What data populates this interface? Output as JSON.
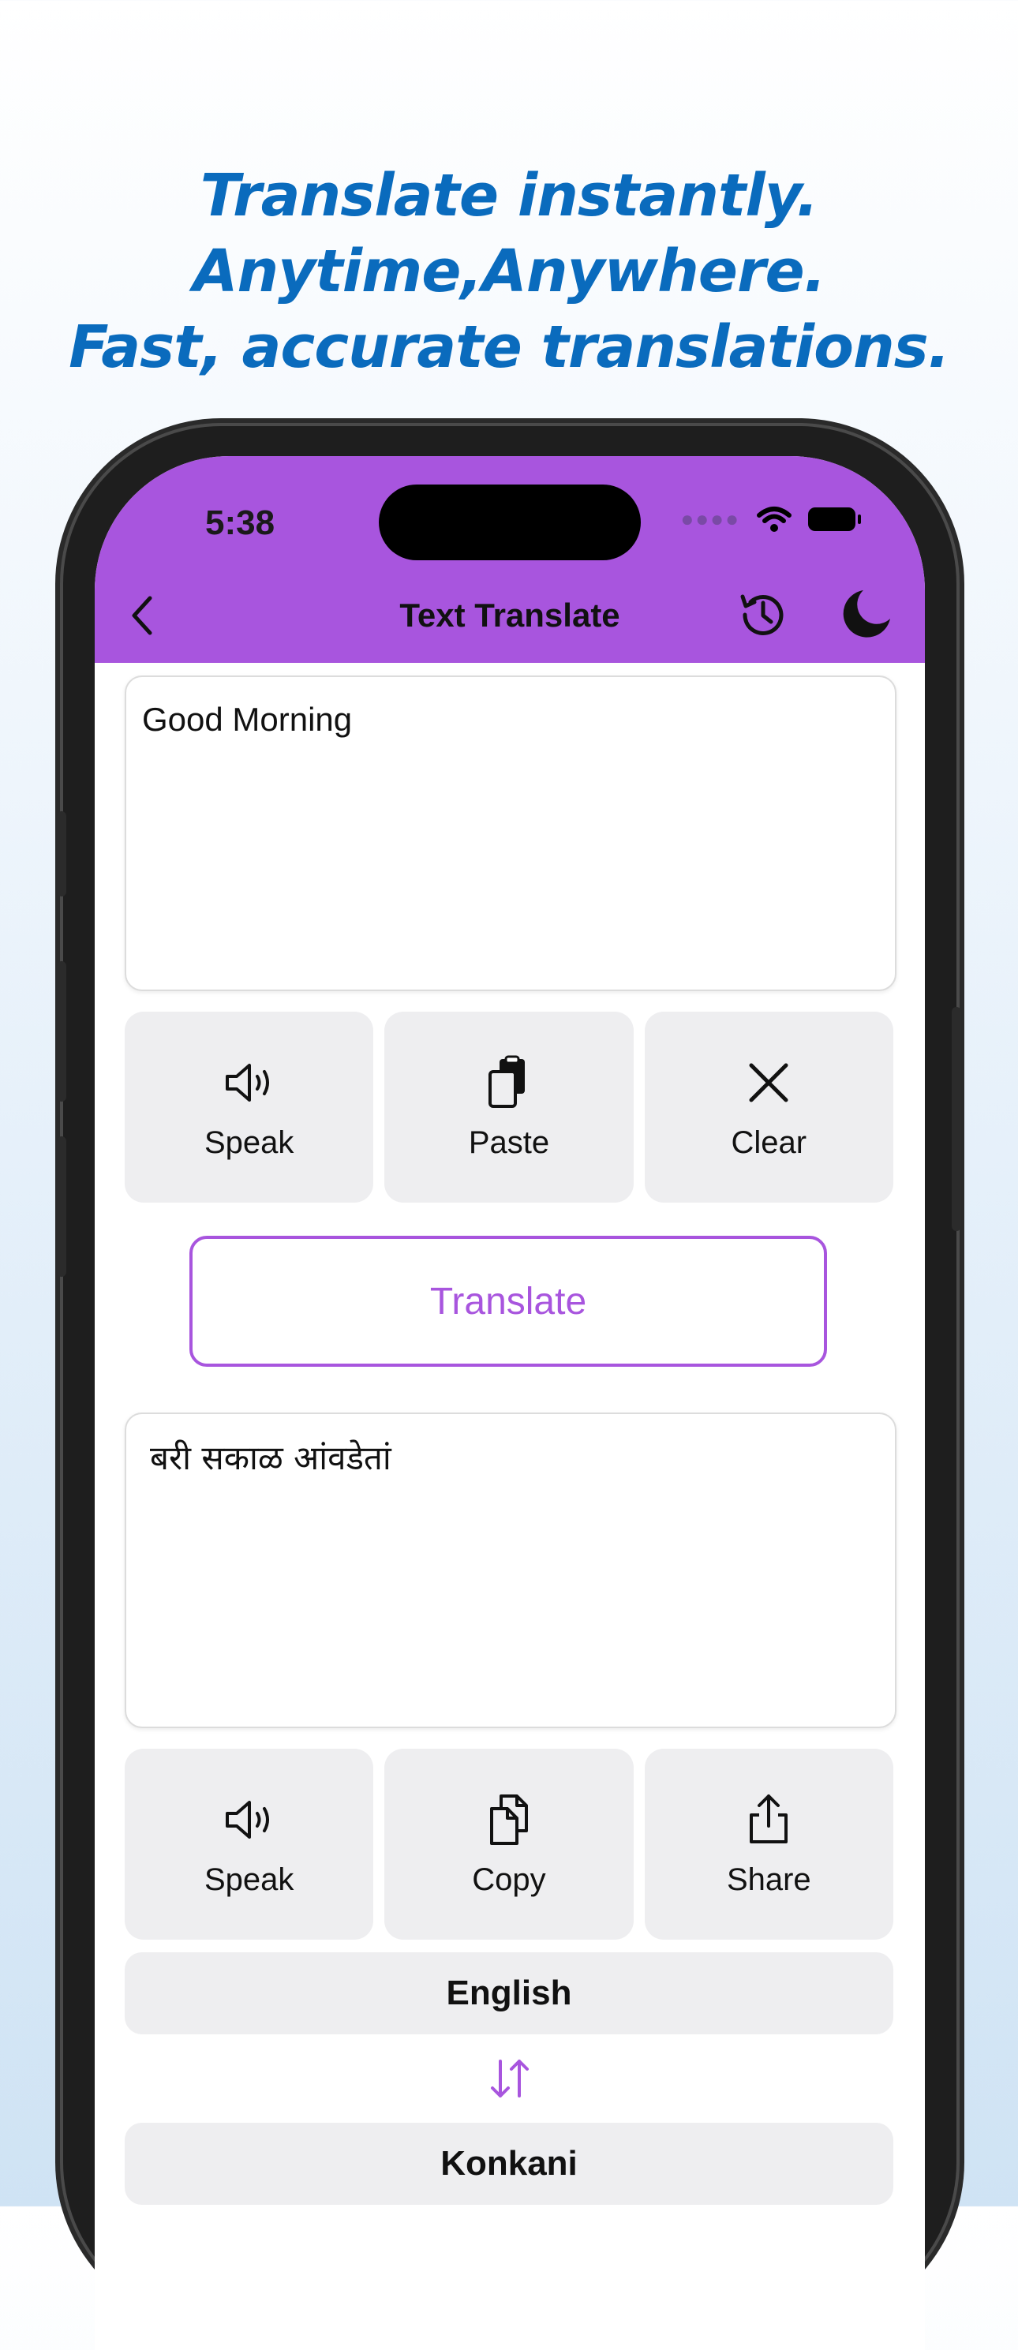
{
  "promo": {
    "line1": "Translate instantly.",
    "line2": "Anytime,Anywhere.",
    "line3": "Fast, accurate translations."
  },
  "status_bar": {
    "time": "5:38"
  },
  "nav": {
    "title": "Text Translate"
  },
  "input": {
    "text": "Good Morning"
  },
  "input_actions": {
    "speak": "Speak",
    "paste": "Paste",
    "clear": "Clear"
  },
  "translate_button": "Translate",
  "output": {
    "text": "बरी सकाळ आंवडेतां"
  },
  "output_actions": {
    "speak": "Speak",
    "copy": "Copy",
    "share": "Share"
  },
  "languages": {
    "source": "English",
    "target": "Konkani"
  },
  "colors": {
    "accent": "#a855de",
    "headline": "#0a6bbd",
    "tile": "#eeeef0"
  }
}
